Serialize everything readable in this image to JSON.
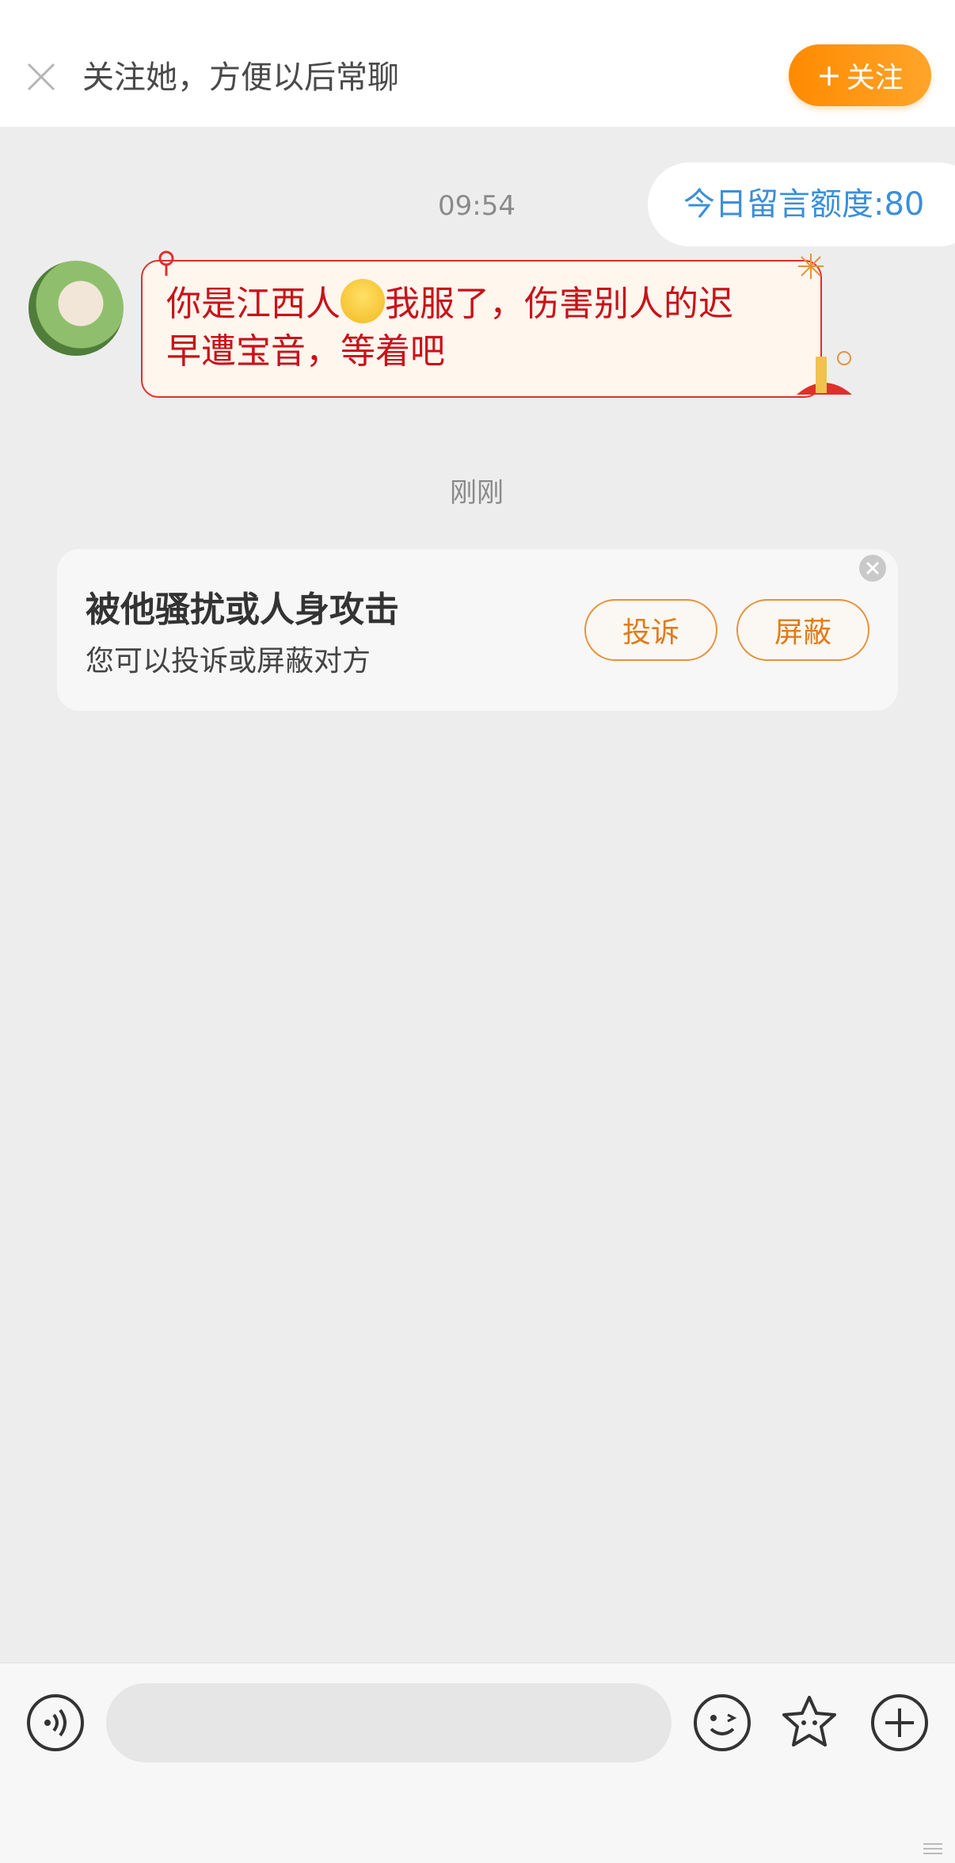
{
  "follow_bar": {
    "text": "关注她，方便以后常聊",
    "button_plus": "+",
    "button_label": "关注"
  },
  "chat": {
    "timestamp_1": "09:54",
    "quota_label": "今日留言额度:80",
    "message_line1": "你是江西人",
    "message_line1_rest": "我服了，伤害别人的迟",
    "message_line2": "早遭宝音，等着吧",
    "timestamp_2": "刚刚"
  },
  "harassment_card": {
    "title": "被他骚扰或人身攻击",
    "subtitle": "您可以投诉或屏蔽对方",
    "report_label": "投诉",
    "block_label": "屏蔽"
  },
  "input_bar": {
    "placeholder": ""
  },
  "colors": {
    "accent_orange": "#ff8a00",
    "quota_blue": "#3b8fd8",
    "message_red": "#c8121a"
  },
  "icons": [
    "close-icon",
    "voice-icon",
    "emoji-icon",
    "sticker-icon",
    "plus-icon"
  ]
}
